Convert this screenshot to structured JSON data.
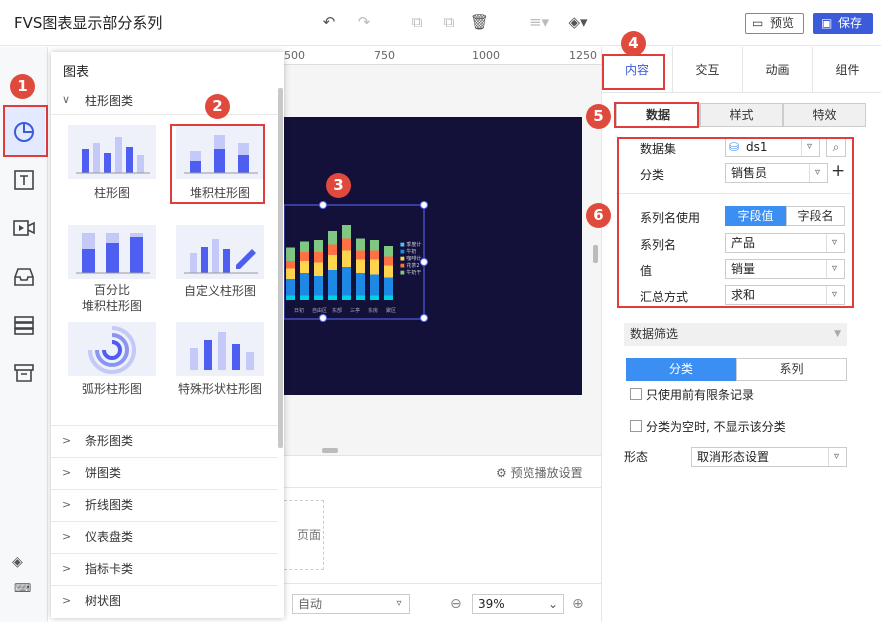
{
  "app": {
    "title": "FVS图表显示部分系列"
  },
  "toolbar": {
    "undo_icon": "undo-icon",
    "redo_icon": "redo-icon",
    "preview_label": "预览",
    "save_label": "保存"
  },
  "chart_panel": {
    "header": "图表",
    "open_category": "柱形图类",
    "items": [
      {
        "label": "柱形图"
      },
      {
        "label": "堆积柱形图"
      },
      {
        "label": "百分比\n堆积柱形图"
      },
      {
        "label": "自定义柱形图"
      },
      {
        "label": "弧形柱形图"
      },
      {
        "label": "特殊形状柱形图"
      }
    ],
    "categories": [
      "条形图类",
      "饼图类",
      "折线图类",
      "仪表盘类",
      "指标卡类",
      "树状图"
    ]
  },
  "ruler": {
    "marks": [
      "500",
      "750",
      "1000",
      "1250"
    ]
  },
  "canvas": {
    "chart_legend": [
      "季度计",
      "牛奶",
      "咖啡计",
      "花茶2",
      "牛奶干"
    ],
    "x_labels": [
      "日初",
      "自由区",
      "东部",
      "三亭",
      "东房",
      "聚区"
    ],
    "preview_setting": "预览播放设置",
    "page_label": "页面",
    "mode_select": "自动",
    "zoom": "39%"
  },
  "right_panel": {
    "tabs": [
      "内容",
      "交互",
      "动画",
      "组件"
    ],
    "sub_tabs": [
      "数据",
      "样式",
      "特效"
    ],
    "dataset_label": "数据集",
    "dataset_value": "ds1",
    "category_label": "分类",
    "category_value": "销售员",
    "series_name_use_label": "系列名使用",
    "toggle_field_value": "字段值",
    "toggle_field_name": "字段名",
    "series_name_label": "系列名",
    "series_name_value": "产品",
    "value_label": "值",
    "value_value": "销量",
    "agg_label": "汇总方式",
    "agg_value": "求和",
    "filter_header": "数据筛选",
    "filter_tabs": [
      "分类",
      "系列"
    ],
    "only_top_label": "只使用前有限条记录",
    "hide_empty_label": "分类为空时, 不显示该分类",
    "shape_label": "形态",
    "shape_value": "取消形态设置"
  },
  "badges": [
    "1",
    "2",
    "3",
    "4",
    "5",
    "6"
  ],
  "colors": {
    "accent": "#3b5bdb",
    "badge": "#e04a3c",
    "highlight": "#e03c3c",
    "dark_canvas": "#13113a",
    "active_toggle": "#3b8ff3"
  }
}
